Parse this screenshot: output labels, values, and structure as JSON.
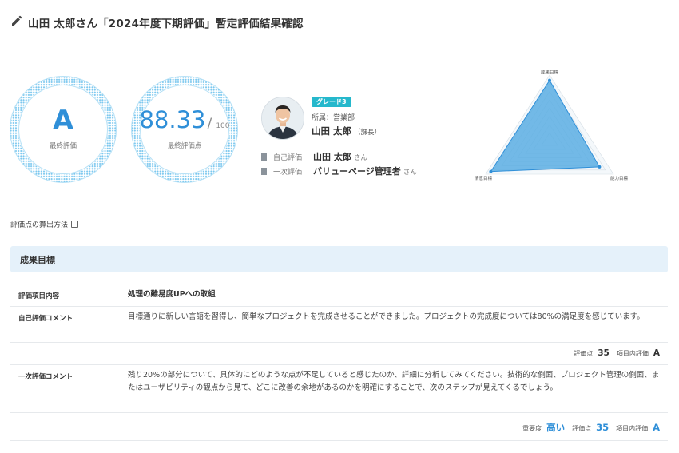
{
  "header": {
    "title": "山田 太郎さん「2024年度下期評価」暫定評価結果確認"
  },
  "final_grade": {
    "value": "A",
    "label": "最終評価"
  },
  "final_score": {
    "value": "88.33",
    "max": "100",
    "label": "最終評価点"
  },
  "profile": {
    "grade_badge": "グレード3",
    "dept": "所属：営業部",
    "name": "山田 太郎",
    "position": "（課長）",
    "self_eval": {
      "label": "自己評価",
      "name": "山田 太郎",
      "suffix": "さん"
    },
    "first_eval": {
      "label": "一次評価",
      "name": "バリューページ管理者",
      "suffix": "さん"
    }
  },
  "radar": {
    "labels": [
      "成果目標",
      "能力目標",
      "情意目標"
    ],
    "values": [
      0.92,
      0.78,
      0.92
    ],
    "colors": {
      "fill": "#5aaee3",
      "stroke": "#2f8fd8"
    }
  },
  "calc_link": "評価点の算出方法",
  "section": {
    "title": "成果目標"
  },
  "table": {
    "item_label": "評価項目内容",
    "item_value": "処理の難易度UPへの取組",
    "self_label": "自己評価コメント",
    "self_comment": "目標通りに新しい言語を習得し、簡単なプロジェクトを完成させることができました。プロジェクトの完成度については80%の満足度を感じています。",
    "self_score_label": "評価点",
    "self_score": "35",
    "self_rating_label": "項目内評価",
    "self_rating": "A",
    "first_label": "一次評価コメント",
    "first_comment": "残り20%の部分について、具体的にどのような点が不足していると感じたのか、詳細に分析してみてください。技術的な側面、プロジェクト管理の側面、またはユーザビリティの観点から見て、どこに改善の余地があるのかを明確にすることで、次のステップが見えてくるでしょう。",
    "importance_label": "重要度",
    "importance": "高い",
    "first_score_label": "評価点",
    "first_score": "35",
    "first_rating_label": "項目内評価",
    "first_rating": "A"
  }
}
